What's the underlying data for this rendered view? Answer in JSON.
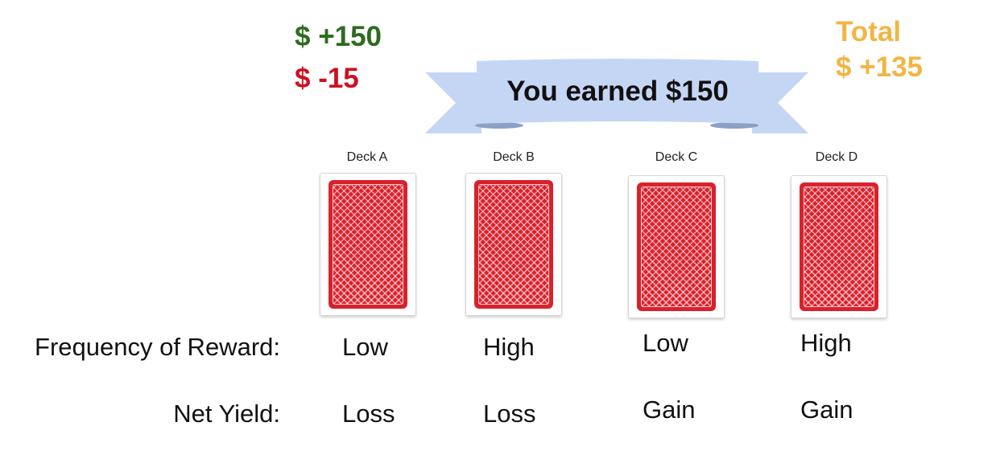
{
  "score": {
    "gain": "$ +150",
    "loss": "$ -15",
    "total_label": "Total",
    "total_value": "$ +135"
  },
  "banner": {
    "text": "You earned $150"
  },
  "decks": [
    {
      "label": "Deck A",
      "frequency": "Low",
      "net_yield": "Loss"
    },
    {
      "label": "Deck B",
      "frequency": "High",
      "net_yield": "Loss"
    },
    {
      "label": "Deck C",
      "frequency": "Low",
      "net_yield": "Gain"
    },
    {
      "label": "Deck D",
      "frequency": "High",
      "net_yield": "Gain"
    }
  ],
  "rows": {
    "frequency_label": "Frequency of Reward:",
    "net_yield_label": "Net Yield:"
  },
  "colors": {
    "gain": "#2e6b1f",
    "loss": "#cc1122",
    "total": "#f2b544",
    "banner": "#c5d6f5",
    "card_back": "#d9212c"
  }
}
